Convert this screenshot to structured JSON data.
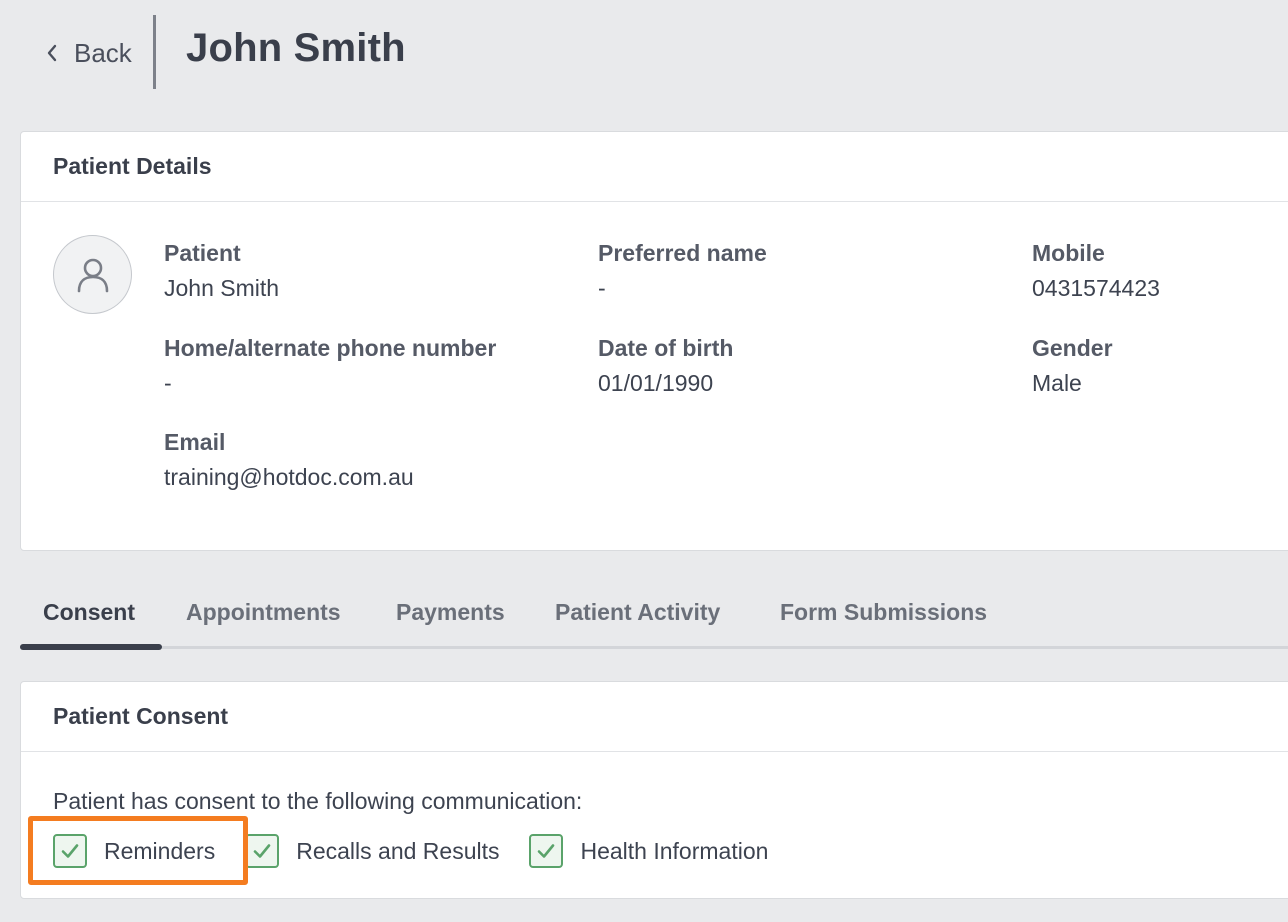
{
  "header": {
    "back_label": "Back",
    "title": "John Smith"
  },
  "patient_details": {
    "heading": "Patient Details",
    "fields": {
      "patient": {
        "label": "Patient",
        "value": "John Smith"
      },
      "preferred_name": {
        "label": "Preferred name",
        "value": "-"
      },
      "mobile": {
        "label": "Mobile",
        "value": "0431574423"
      },
      "home_phone": {
        "label": "Home/alternate phone number",
        "value": "-"
      },
      "dob": {
        "label": "Date of birth",
        "value": "01/01/1990"
      },
      "gender": {
        "label": "Gender",
        "value": "Male"
      },
      "email": {
        "label": "Email",
        "value": "training@hotdoc.com.au"
      }
    },
    "avatar_icon": "user-icon"
  },
  "tabs": [
    {
      "label": "Consent",
      "active": true
    },
    {
      "label": "Appointments",
      "active": false
    },
    {
      "label": "Payments",
      "active": false
    },
    {
      "label": "Patient Activity",
      "active": false
    },
    {
      "label": "Form Submissions",
      "active": false
    }
  ],
  "consent": {
    "heading": "Patient Consent",
    "description": "Patient has consent to the following communication:",
    "items": [
      {
        "label": "Reminders",
        "checked": true
      },
      {
        "label": "Recalls and Results",
        "checked": true
      },
      {
        "label": "Health Information",
        "checked": true
      }
    ]
  },
  "colors": {
    "check_green": "#5aa36a",
    "highlight_orange": "#f47c20",
    "background": "#e9eaec"
  }
}
